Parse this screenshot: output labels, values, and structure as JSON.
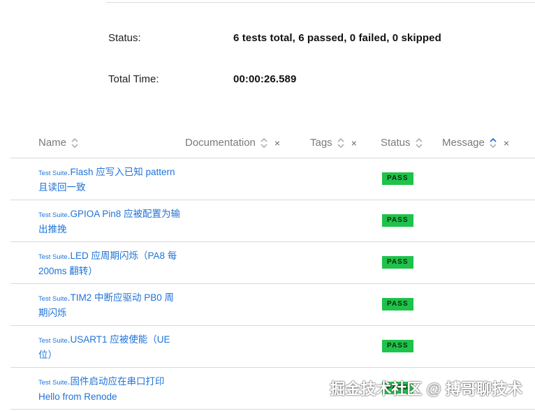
{
  "summary": {
    "status_label": "Status:",
    "status_value": "6 tests total, 6 passed, 0 failed, 0 skipped",
    "time_label": "Total Time:",
    "time_value": "00:00:26.589"
  },
  "table": {
    "columns": {
      "name": "Name",
      "documentation": "Documentation",
      "tags": "Tags",
      "status": "Status",
      "message": "Message"
    },
    "close_glyph": "×",
    "rows": [
      {
        "prefix": "Test Suite",
        "sep": ".",
        "name": "Flash 应写入已知 pattern 且读回一致",
        "status": "PASS"
      },
      {
        "prefix": "Test Suite",
        "sep": ".",
        "name": "GPIOA Pin8 应被配置为输出推挽",
        "status": "PASS"
      },
      {
        "prefix": "Test Suite",
        "sep": ".",
        "name": "LED 应周期闪烁（PA8 每 200ms 翻转）",
        "status": "PASS"
      },
      {
        "prefix": "Test Suite",
        "sep": ".",
        "name": "TIM2 中断应驱动 PB0 周期闪烁",
        "status": "PASS"
      },
      {
        "prefix": "Test Suite",
        "sep": ".",
        "name": "USART1 应被使能（UE 位）",
        "status": "PASS"
      },
      {
        "prefix": "Test Suite",
        "sep": ".",
        "name": "固件启动应在串口打印 Hello from Renode",
        "status": "PASS"
      }
    ]
  },
  "watermark": "掘金技术社区 @ 搏哥聊技术",
  "colors": {
    "link": "#1f73d9",
    "pass_badge": "#1fc24a",
    "sort_active": "#1f73d9"
  }
}
